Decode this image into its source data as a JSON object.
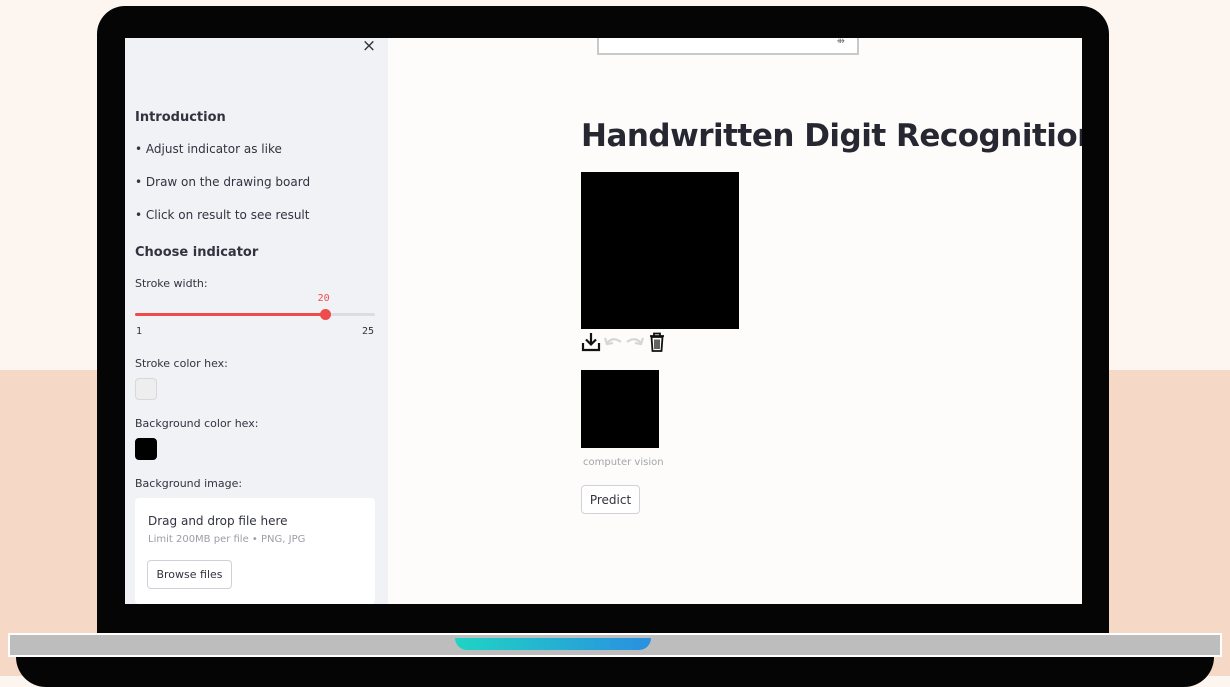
{
  "sidebar": {
    "close_glyph": "×",
    "introduction_heading": "Introduction",
    "bullets": [
      "• Adjust indicator as like",
      "• Draw on the drawing board",
      "• Click on result to see result"
    ],
    "choose_heading": "Choose indicator",
    "stroke_width": {
      "label": "Stroke width:",
      "value": "20",
      "min": "1",
      "max": "25",
      "fraction": 0.79
    },
    "stroke_color": {
      "label": "Stroke color hex:",
      "value": "#EEEEEE"
    },
    "background_color": {
      "label": "Background color hex:",
      "value": "#000000"
    },
    "background_image": {
      "label": "Background image:",
      "drop_text": "Drag and drop file here",
      "limit_text": "Limit 200MB per file • PNG, JPG",
      "browse_label": "Browse files"
    }
  },
  "main": {
    "title": "Handwritten Digit Recognition",
    "toolbar_icons": [
      "download-icon",
      "undo-icon",
      "redo-icon",
      "trash-icon"
    ],
    "result_caption": "computer vision",
    "predict_label": "Predict"
  },
  "colors": {
    "accent": "#F04B4B",
    "sidebar_bg": "#F0F2F6",
    "text": "#31333F"
  }
}
